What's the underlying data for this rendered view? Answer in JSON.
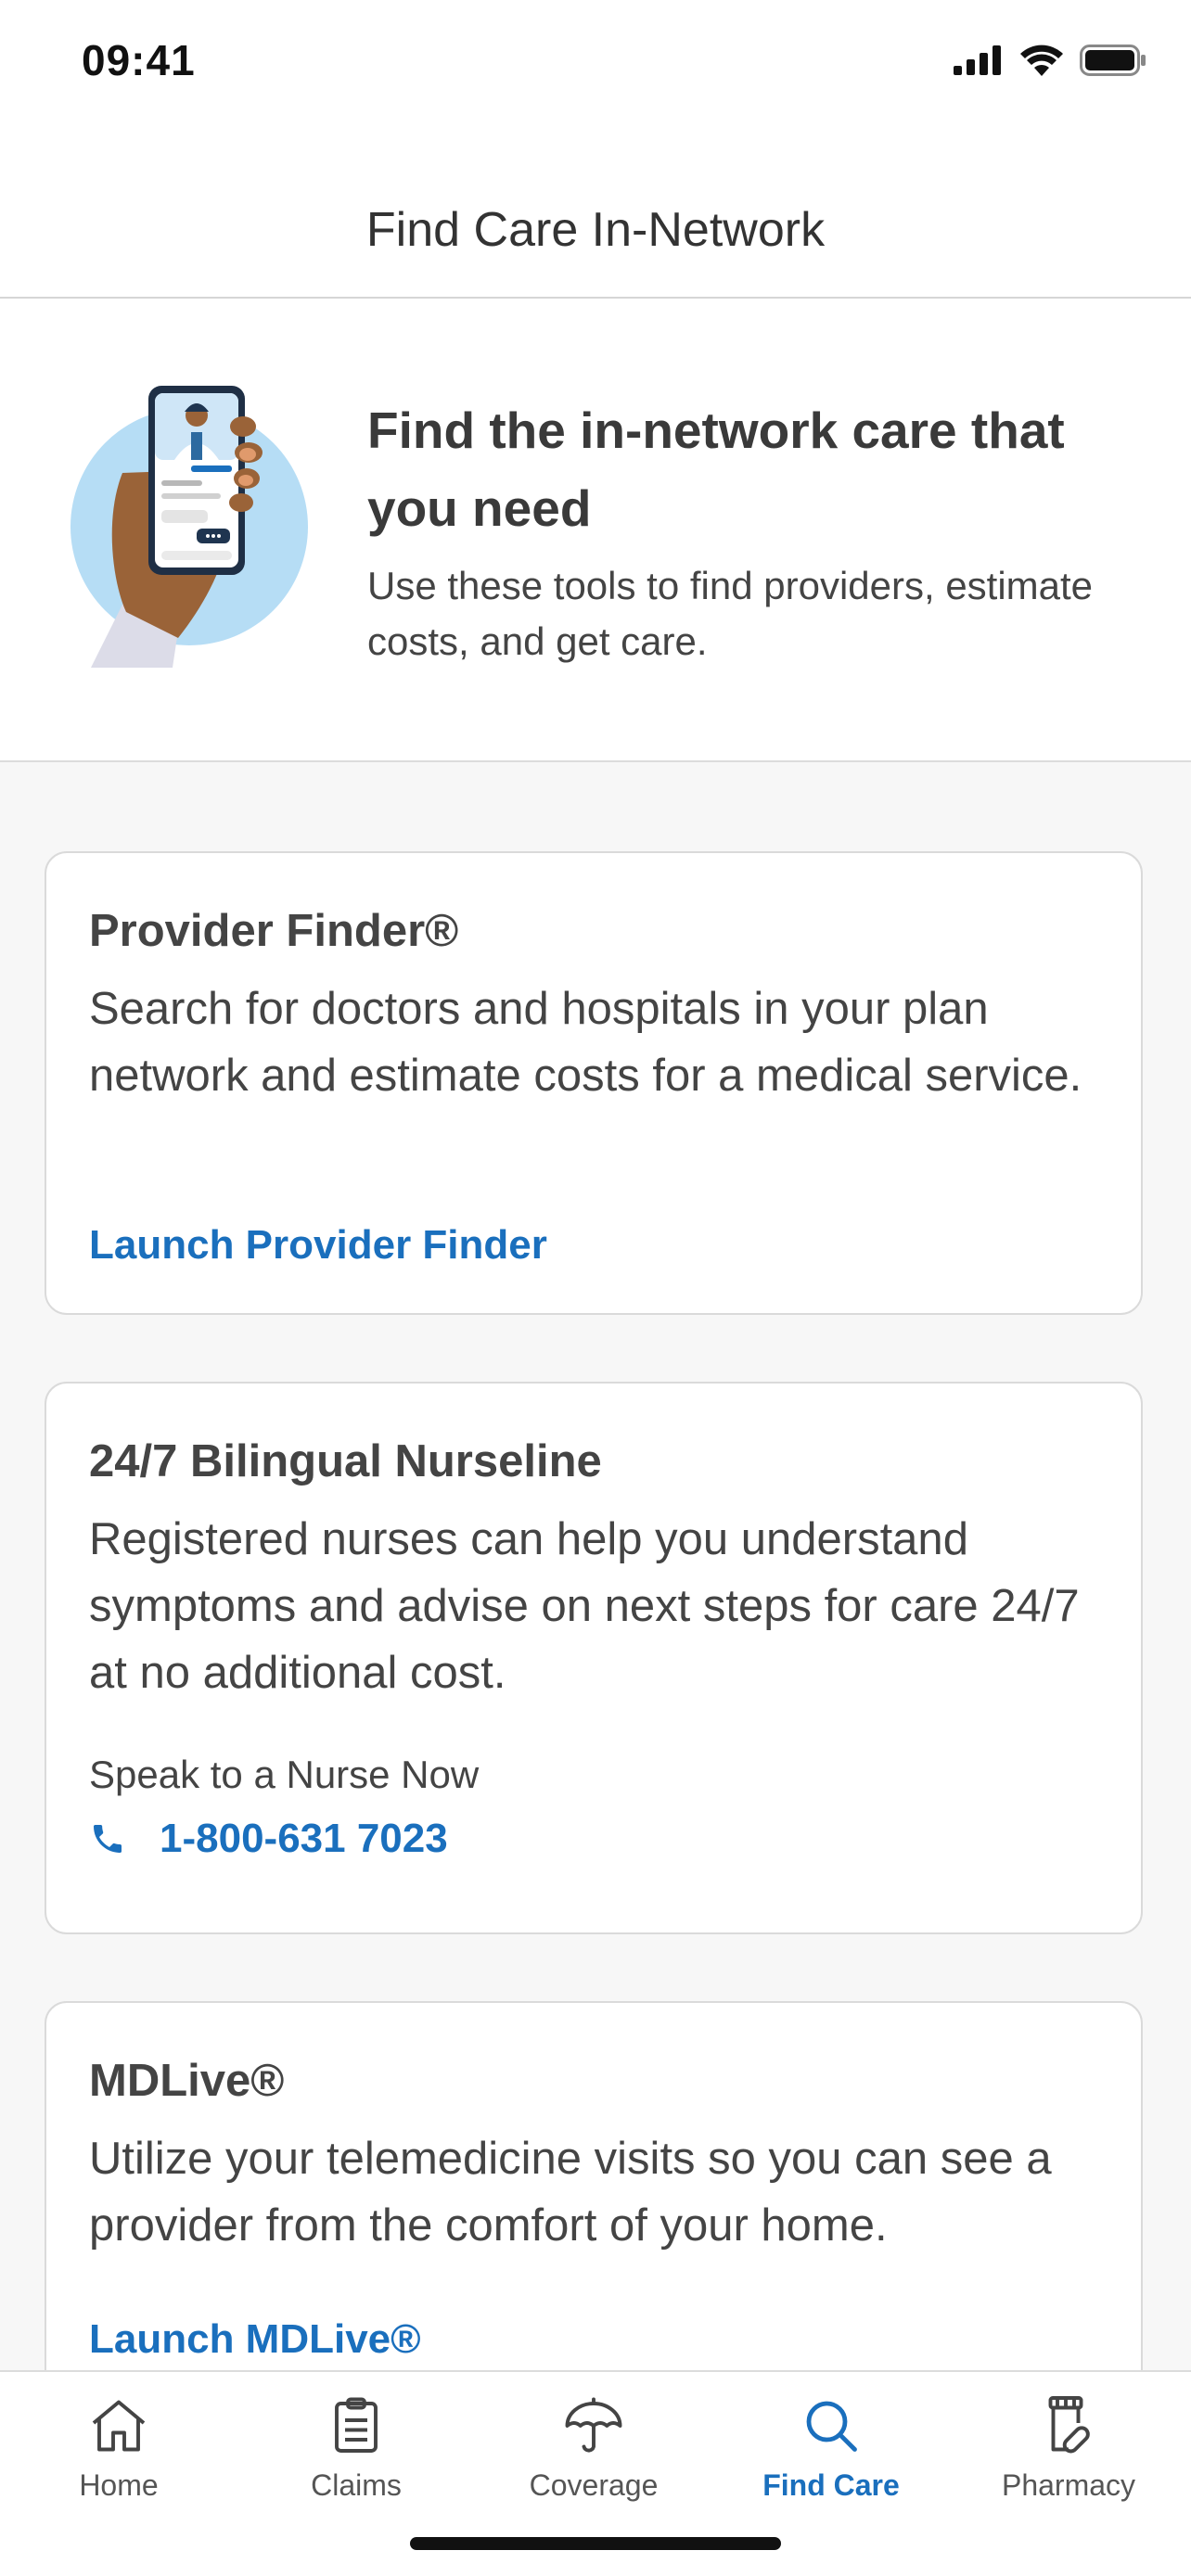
{
  "status_bar": {
    "time": "09:41"
  },
  "header": {
    "title": "Find Care In-Network"
  },
  "hero": {
    "title": "Find the in-network care that you need",
    "description": "Use these tools to find providers, estimate costs, and get care."
  },
  "cards": [
    {
      "title": "Provider Finder®",
      "body": "Search for doctors and hospitals in your plan network and estimate costs for a medical service.",
      "link": "Launch Provider Finder"
    },
    {
      "title": "24/7 Bilingual Nurseline",
      "body": "Registered nurses can help you understand symptoms and advise on next steps for care 24/7 at no additional cost.",
      "sub_label": "Speak to a Nurse Now",
      "phone": "1-800-631 7023"
    },
    {
      "title": "MDLive®",
      "body": "Utilize your telemedicine visits so you can see a provider from the comfort of your home.",
      "link": "Launch MDLive®"
    }
  ],
  "tabs": [
    {
      "label": "Home",
      "icon": "home-icon"
    },
    {
      "label": "Claims",
      "icon": "clipboard-icon"
    },
    {
      "label": "Coverage",
      "icon": "umbrella-icon"
    },
    {
      "label": "Find Care",
      "icon": "search-icon",
      "active": true
    },
    {
      "label": "Pharmacy",
      "icon": "pill-bottle-icon"
    }
  ],
  "colors": {
    "accent": "#1a6fbd",
    "text": "#444444",
    "background": "#f7f7f7"
  }
}
